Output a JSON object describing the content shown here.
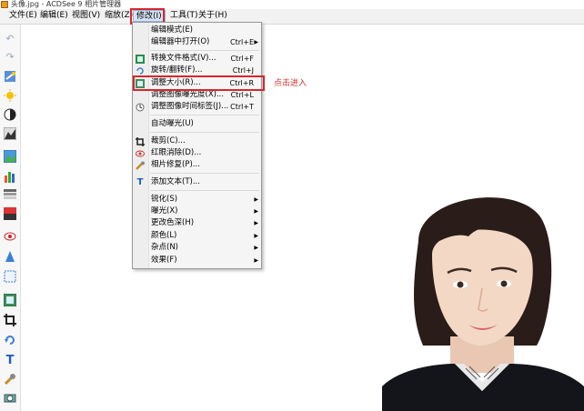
{
  "window": {
    "title": "头像.jpg - ACDSee 9 相片管理器"
  },
  "menubar": {
    "items": [
      "文件(E)",
      "编辑(E)",
      "视图(V)",
      "缩放(Z)",
      "修改(I)",
      "工具(T)",
      "关于(H)"
    ],
    "active": "修改(I)"
  },
  "modify_menu": {
    "items": [
      {
        "label": "编辑模式(E)",
        "shortcut": "",
        "icon": ""
      },
      {
        "label": "编辑器中打开(O)",
        "shortcut": "Ctrl+E",
        "icon": "",
        "submenu": true
      },
      {
        "label": "转换文件格式(V)...",
        "shortcut": "Ctrl+F",
        "icon": "convert-icon"
      },
      {
        "label": "旋转/翻转(F)...",
        "shortcut": "Ctrl+J",
        "icon": "rotate-icon"
      },
      {
        "label": "调整大小(R)...",
        "shortcut": "Ctrl+R",
        "icon": "resize-icon"
      },
      {
        "label": "调整图像曝光度(X)...",
        "shortcut": "Ctrl+L",
        "icon": ""
      },
      {
        "label": "调整图像时间标签(J)...",
        "shortcut": "Ctrl+T",
        "icon": "timestamp-icon"
      },
      {
        "label": "自动曝光(U)",
        "shortcut": "",
        "icon": ""
      },
      {
        "label": "裁剪(C)...",
        "shortcut": "",
        "icon": "crop-icon"
      },
      {
        "label": "红眼消除(D)...",
        "shortcut": "",
        "icon": "red-eye-icon"
      },
      {
        "label": "相片修复(P)...",
        "shortcut": "",
        "icon": "repair-icon"
      },
      {
        "label": "添加文本(T)...",
        "shortcut": "",
        "icon": "text-icon"
      },
      {
        "label": "锐化(S)",
        "shortcut": "",
        "icon": "",
        "submenu": true
      },
      {
        "label": "曝光(X)",
        "shortcut": "",
        "icon": "",
        "submenu": true
      },
      {
        "label": "更改色深(H)",
        "shortcut": "",
        "icon": "",
        "submenu": true
      },
      {
        "label": "颜色(L)",
        "shortcut": "",
        "icon": "",
        "submenu": true
      },
      {
        "label": "杂点(N)",
        "shortcut": "",
        "icon": "",
        "submenu": true
      },
      {
        "label": "效果(F)",
        "shortcut": "",
        "icon": "",
        "submenu": true
      }
    ]
  },
  "annotation": {
    "text": "点击进入"
  },
  "toolbar": {
    "icons": [
      "undo-icon",
      "redo-icon",
      "auto-fix-icon",
      "brightness-icon",
      "contrast-icon",
      "levels-icon",
      "image-icon",
      "histogram-icon",
      "filter-icon",
      "gradient-icon",
      "red-eye-icon",
      "sharpen-icon",
      "dotted-frame-icon",
      "resize-icon",
      "crop-icon",
      "rotate-icon",
      "text-icon",
      "repair-icon",
      "camera-icon"
    ]
  },
  "colors": {
    "highlight_red": "#d8262d",
    "annotation_red": "#d12f2f"
  }
}
